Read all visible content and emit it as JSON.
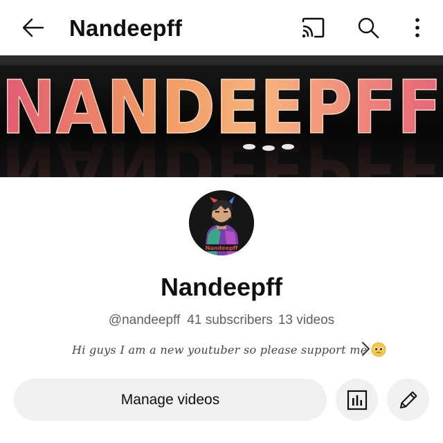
{
  "header": {
    "title": "Nandeepff",
    "icons": [
      "back-arrow-icon",
      "cast-icon",
      "search-icon",
      "more-vert-icon"
    ]
  },
  "banner": {
    "text": "NANDEEPFF",
    "colors": [
      "#e25a73",
      "#f29a62",
      "#f7b27c",
      "#e8627a"
    ]
  },
  "avatar": {
    "caption": "Nandeepff"
  },
  "channel": {
    "name": "Nandeepff",
    "handle": "@nandeepff",
    "subscribers": "41 subscribers",
    "videos": "13 videos",
    "description": "Hi guys I am a new youtuber so please support me"
  },
  "actions": {
    "manage_videos": "Manage videos",
    "analytics_icon": "analytics-icon",
    "edit_icon": "pencil-icon"
  }
}
